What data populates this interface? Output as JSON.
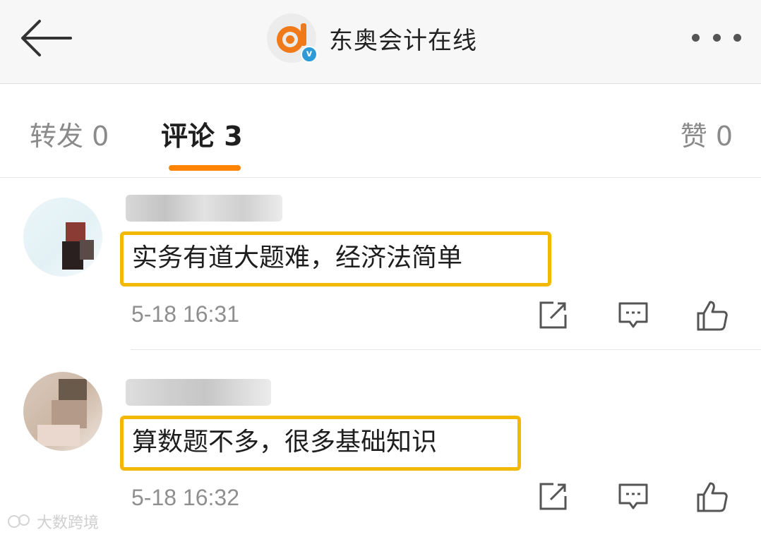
{
  "header": {
    "account_name": "东奥会计在线",
    "verified_badge": "v",
    "back_icon": "back-arrow-icon",
    "more_icon": "more-dots-icon"
  },
  "tabs": [
    {
      "label": "转发 0",
      "active": false
    },
    {
      "label": "评论 3",
      "active": true
    },
    {
      "label": "赞 0",
      "active": false
    }
  ],
  "comments": [
    {
      "text": "实务有道大题难，经济法简单",
      "time": "5-18 16:31"
    },
    {
      "text": "算数题不多，很多基础知识",
      "time": "5-18 16:32"
    }
  ],
  "actions": {
    "share_icon": "share-icon",
    "reply_icon": "comment-icon",
    "like_icon": "thumbs-up-icon"
  },
  "watermark": {
    "text": "大数跨境"
  },
  "colors": {
    "accent": "#ff8200",
    "highlight_border": "#f3b800",
    "verified": "#2c9bd8"
  }
}
